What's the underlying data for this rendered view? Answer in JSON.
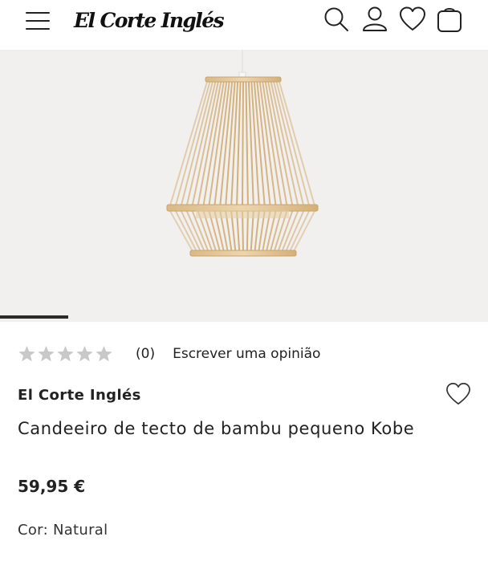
{
  "header": {
    "logo_text": "El Corte Inglés",
    "icons": [
      "menu-icon",
      "search-icon",
      "user-icon",
      "heart-icon",
      "bag-icon"
    ]
  },
  "gallery": {
    "image_subject": "lamp-image",
    "progress": 0.14
  },
  "rating": {
    "stars": 0,
    "max_stars": 5,
    "count": "(0)",
    "write_review_label": "Escrever uma opinião"
  },
  "product": {
    "brand": "El Corte Inglés",
    "title": "Candeeiro de tecto de bambu pequeno Kobe",
    "price": "59,95 €",
    "color_label": "Cor: Natural"
  },
  "colors": {
    "text": "#222222",
    "star_empty": "#c8c8c8",
    "gallery_bg": "#f1f0ee",
    "bamboo": "#e3c79a"
  }
}
